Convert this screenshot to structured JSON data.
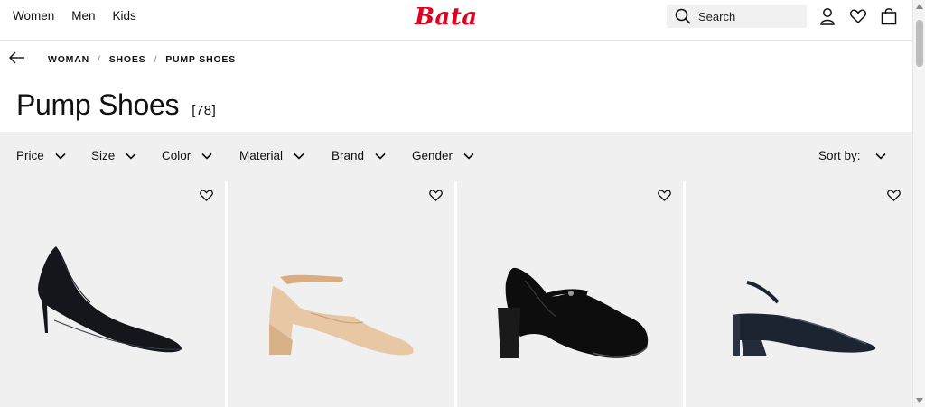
{
  "header": {
    "nav": [
      "Women",
      "Men",
      "Kids"
    ],
    "logo": "Bata",
    "search_label": "Search",
    "brand_color": "#e1001e"
  },
  "breadcrumb": [
    "WOMAN",
    "SHOES",
    "PUMP SHOES"
  ],
  "page": {
    "title": "Pump Shoes",
    "count": "[78]"
  },
  "filters": [
    "Price",
    "Size",
    "Color",
    "Material",
    "Brand",
    "Gender"
  ],
  "sort_label": "Sort by:",
  "products": [
    {
      "icon": "black-stiletto-pump-image",
      "color": "#14161c"
    },
    {
      "icon": "nude-ankle-strap-block-heel-image",
      "color": "#e7c7a4"
    },
    {
      "icon": "black-patent-mary-jane-image",
      "color": "#0d0d0d"
    },
    {
      "icon": "navy-patent-slingback-image",
      "color": "#1d2431"
    }
  ]
}
